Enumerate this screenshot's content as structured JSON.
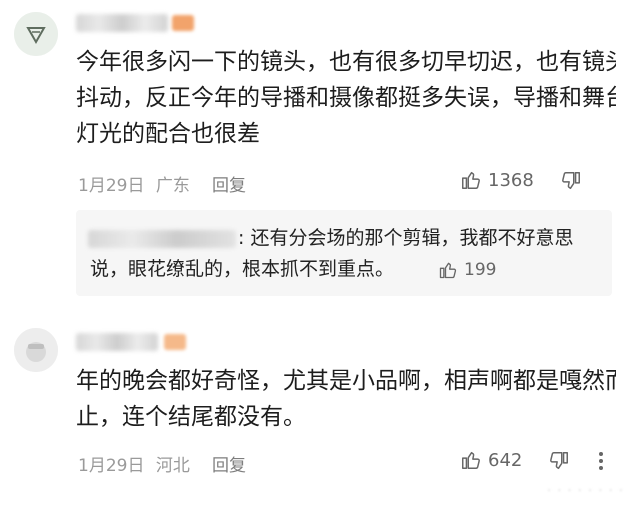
{
  "comments": [
    {
      "text_lines": [
        "今年很多闪一下的镜头，也有很多切早切迟，也有镜头",
        "抖动，反正今年的导播和摄像都挺多失误，导播和舞台",
        "灯光的配合也很差"
      ],
      "date": "1月29日",
      "location": "广东",
      "reply_label": "回复",
      "like_count": "1368",
      "sub_reply": {
        "text_lines": [
          ": 还有分会场的那个剪辑，我都不好意思",
          "说，眼花缭乱的，根本抓不到重点。"
        ],
        "like_count": "199"
      }
    },
    {
      "text_lines": [
        "年的晚会都好奇怪，尤其是小品啊，相声啊都是嘎然而",
        "止，连个结尾都没有。"
      ],
      "date": "1月29日",
      "location": "河北",
      "reply_label": "回复",
      "like_count": "642"
    }
  ],
  "icons": {
    "like": "thumbs-up-icon",
    "dislike": "thumbs-down-icon",
    "more": "more-vertical-icon"
  },
  "colors": {
    "badge_orange": "#f2a36b",
    "meta_gray": "#9a9a9a"
  }
}
